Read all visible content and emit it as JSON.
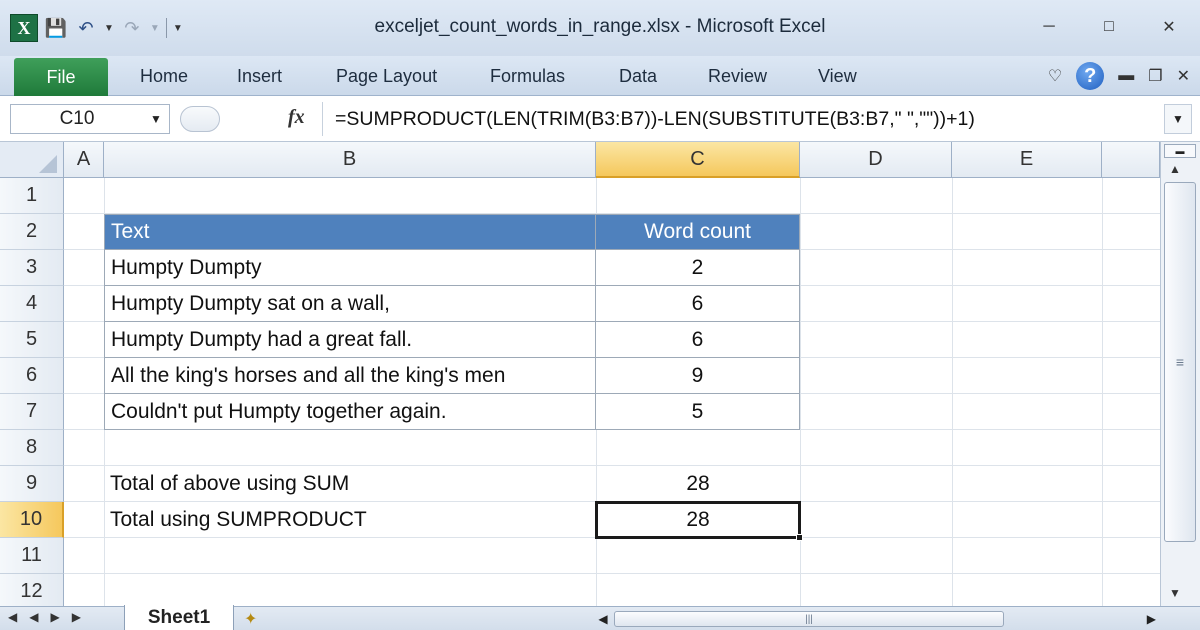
{
  "window": {
    "title": "exceljet_count_words_in_range.xlsx  -  Microsoft Excel",
    "logo_letter": "X"
  },
  "ribbon": {
    "file_label": "File",
    "tabs": [
      "Home",
      "Insert",
      "Page Layout",
      "Formulas",
      "Data",
      "Review",
      "View"
    ]
  },
  "formula_bar": {
    "name_box": "C10",
    "fx_label": "fx",
    "formula": "=SUMPRODUCT(LEN(TRIM(B3:B7))-LEN(SUBSTITUTE(B3:B7,\" \",\"\"))+1)"
  },
  "columns": [
    "A",
    "B",
    "C",
    "D",
    "E"
  ],
  "rows": [
    "1",
    "2",
    "3",
    "4",
    "5",
    "6",
    "7",
    "8",
    "9",
    "10",
    "11",
    "12"
  ],
  "active_cell": {
    "column": "C",
    "row": "10"
  },
  "table": {
    "header_text": "Text",
    "header_count": "Word count",
    "rows": [
      {
        "text": "Humpty Dumpty",
        "count": "2"
      },
      {
        "text": "Humpty Dumpty sat on a wall,",
        "count": "6"
      },
      {
        "text": "Humpty Dumpty had a great fall.",
        "count": "6"
      },
      {
        "text": "All the king's horses and all the king's men",
        "count": "9"
      },
      {
        "text": "Couldn't put Humpty together again.",
        "count": "5"
      }
    ],
    "header_color": "#4f81bd"
  },
  "totals": {
    "sum_label": "Total of above using SUM",
    "sum_value": "28",
    "sumproduct_label": "Total using SUMPRODUCT",
    "sumproduct_value": "28"
  },
  "sheet_tab": "Sheet1"
}
